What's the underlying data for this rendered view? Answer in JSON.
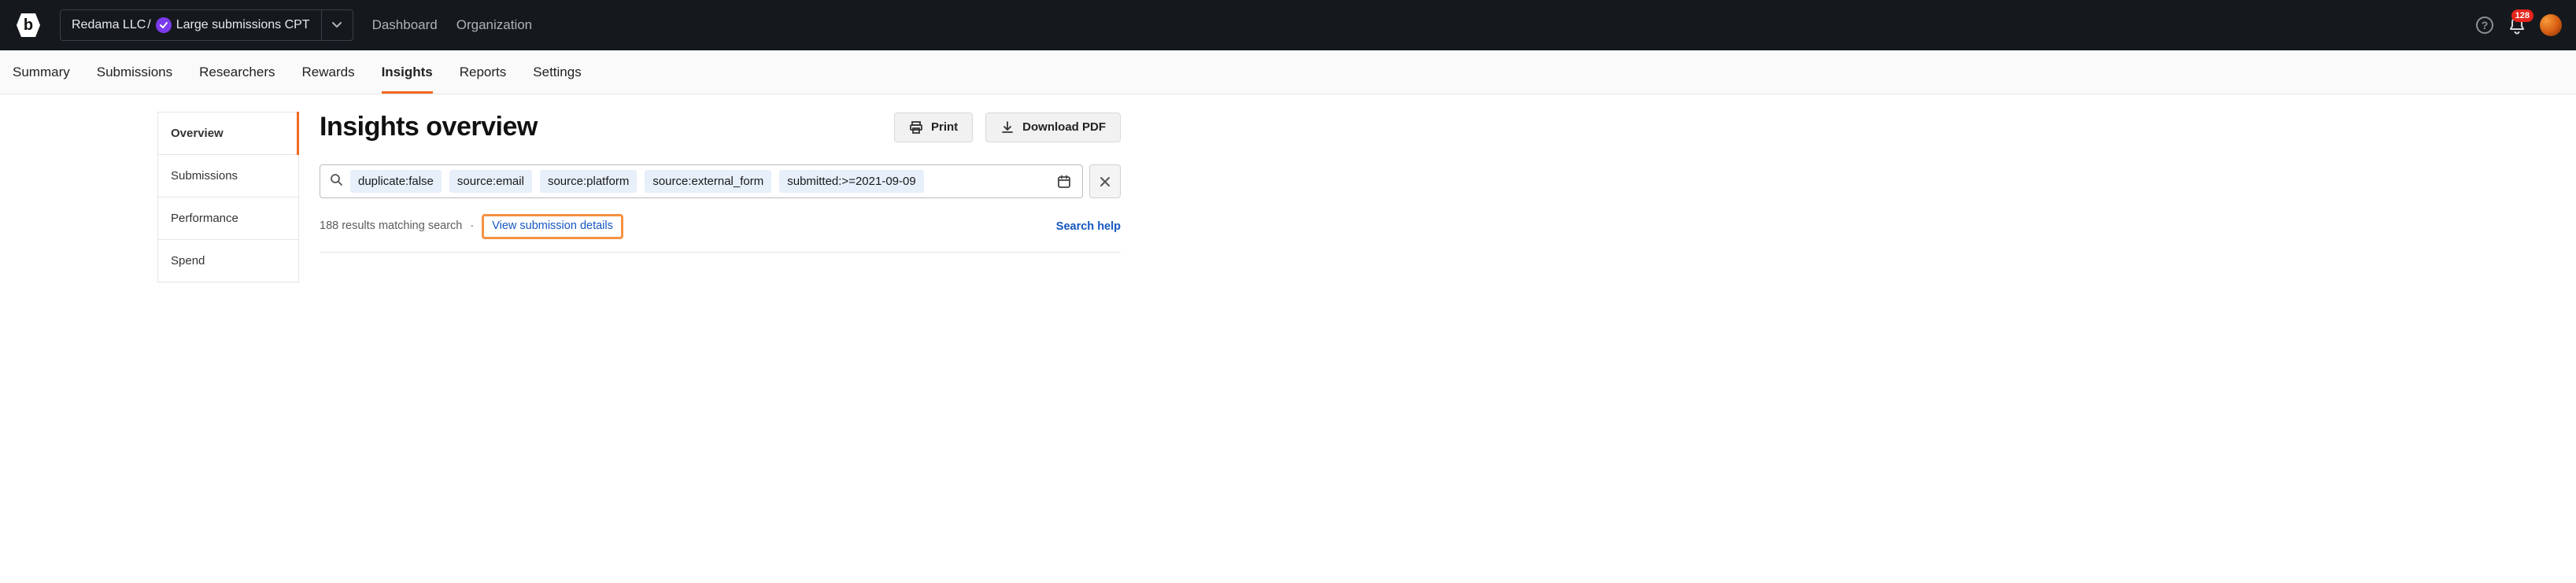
{
  "topbar": {
    "org": "Redama LLC",
    "program": "Large submissions CPT",
    "nav": {
      "dashboard": "Dashboard",
      "organization": "Organization"
    },
    "notification_count": "128"
  },
  "subnav": {
    "summary": "Summary",
    "submissions": "Submissions",
    "researchers": "Researchers",
    "rewards": "Rewards",
    "insights": "Insights",
    "reports": "Reports",
    "settings": "Settings"
  },
  "sidebar": {
    "overview": "Overview",
    "submissions": "Submissions",
    "performance": "Performance",
    "spend": "Spend"
  },
  "page": {
    "title": "Insights overview",
    "print": "Print",
    "download": "Download PDF"
  },
  "search": {
    "chips": {
      "0": "duplicate:false",
      "1": "source:email",
      "2": "source:platform",
      "3": "source:external_form",
      "4": "submitted:>=2021-09-09"
    }
  },
  "results": {
    "summary": "188 results matching search",
    "details_link": "View submission details",
    "search_help": "Search help"
  }
}
